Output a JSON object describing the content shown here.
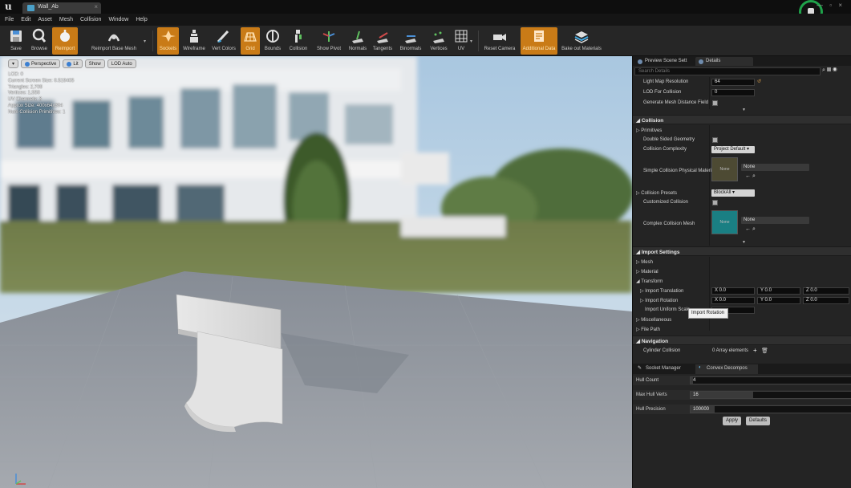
{
  "window": {
    "tab_title": "Wall_Ab"
  },
  "menu": [
    "File",
    "Edit",
    "Asset",
    "Mesh",
    "Collision",
    "Window",
    "Help"
  ],
  "toolbar": [
    {
      "label": "Save",
      "icon": "save-icon",
      "active": false
    },
    {
      "label": "Browse",
      "icon": "browse-icon",
      "active": false
    },
    {
      "label": "Reimport",
      "icon": "reimport-icon",
      "active": true
    },
    {
      "label": "Reimport Base Mesh",
      "icon": "reimport-base-icon",
      "active": false
    },
    {
      "label": "Sockets",
      "icon": "sockets-icon",
      "active": true
    },
    {
      "label": "Wireframe",
      "icon": "wireframe-icon",
      "active": false
    },
    {
      "label": "Vert Colors",
      "icon": "vert-colors-icon",
      "active": false
    },
    {
      "label": "Grid",
      "icon": "grid-icon",
      "active": true
    },
    {
      "label": "Bounds",
      "icon": "bounds-icon",
      "active": false
    },
    {
      "label": "Collision",
      "icon": "collision-icon",
      "active": false
    },
    {
      "label": "Show Pivot",
      "icon": "pivot-icon",
      "active": false
    },
    {
      "label": "Normals",
      "icon": "normals-icon",
      "active": false
    },
    {
      "label": "Tangents",
      "icon": "tangents-icon",
      "active": false
    },
    {
      "label": "Binormals",
      "icon": "binormals-icon",
      "active": false
    },
    {
      "label": "Vertices",
      "icon": "vertices-icon",
      "active": false
    },
    {
      "label": "UV",
      "icon": "uv-icon",
      "active": false
    },
    {
      "label": "Reset Camera",
      "icon": "camera-icon",
      "active": false
    },
    {
      "label": "Additional Data",
      "icon": "additional-data-icon",
      "active": true
    },
    {
      "label": "Bake out Materials",
      "icon": "bake-icon",
      "active": false
    }
  ],
  "viewport": {
    "buttons": [
      "Perspective",
      "Lit",
      "Show",
      "LOD Auto"
    ],
    "stats": [
      "LOD: 0",
      "Current Screen Size: 0.519405",
      "Triangles: 2,709",
      "Vertices: 1,550",
      "UV Channels: 3",
      "Approx Size: 400x64x394",
      "Num Collision Primitives: 1"
    ]
  },
  "panel": {
    "tabs": [
      "Preview Scene Sett",
      "Details"
    ],
    "search_placeholder": "Search Details",
    "lightmap": [
      {
        "label": "Light Map Resolution",
        "value": "64"
      },
      {
        "label": "LOD For Collision",
        "value": "0"
      },
      {
        "label": "Generate Mesh Distance Field",
        "value": ""
      }
    ],
    "collision": {
      "title": "Collision",
      "primitives": "Primitives",
      "double_sided": "Double Sided Geometry",
      "complexity_label": "Collision Complexity",
      "complexity_value": "Project Default",
      "phys_mat_label": "Simple Collision Physical Material",
      "phys_mat_value": "None",
      "thumb_text": "None",
      "presets_label": "Collision Presets",
      "presets_value": "BlockAll",
      "customized_label": "Customized Collision",
      "complex_mesh_label": "Complex Collision Mesh",
      "complex_mesh_value": "None",
      "thumb2_text": "None"
    },
    "import": {
      "title": "Import Settings",
      "mesh": "Mesh",
      "material": "Material",
      "transform": "Transform",
      "translation_label": "Import Translation",
      "translation": {
        "x": "X 0.0",
        "y": "Y 0.0",
        "z": "Z 0.0"
      },
      "rotation_label": "Import Rotation",
      "rotation": {
        "x": "X 0.0",
        "y": "Y 0.0",
        "z": "Z 0.0"
      },
      "uniform_scale_label": "Import Uniform Scale",
      "misc": "Miscellaneous",
      "filepath": "File Path"
    },
    "navigation": {
      "title": "Navigation",
      "cylinder_label": "Cylinder Collision",
      "cylinder_value": "0 Array elements"
    },
    "tooltip": "Import Rotation"
  },
  "convex": {
    "tabs": [
      "Socket Manager",
      "Convex Decompos"
    ],
    "hull_count_label": "Hull Count",
    "hull_count": "4",
    "max_verts_label": "Max Hull Verts",
    "max_verts": "16",
    "precision_label": "Hull Precision",
    "precision": "100000",
    "apply": "Apply",
    "defaults": "Defaults"
  },
  "colors": {
    "accent": "#c97b17",
    "teal_thumb": "#1a7f83",
    "olive_thumb": "#4d4a33"
  }
}
